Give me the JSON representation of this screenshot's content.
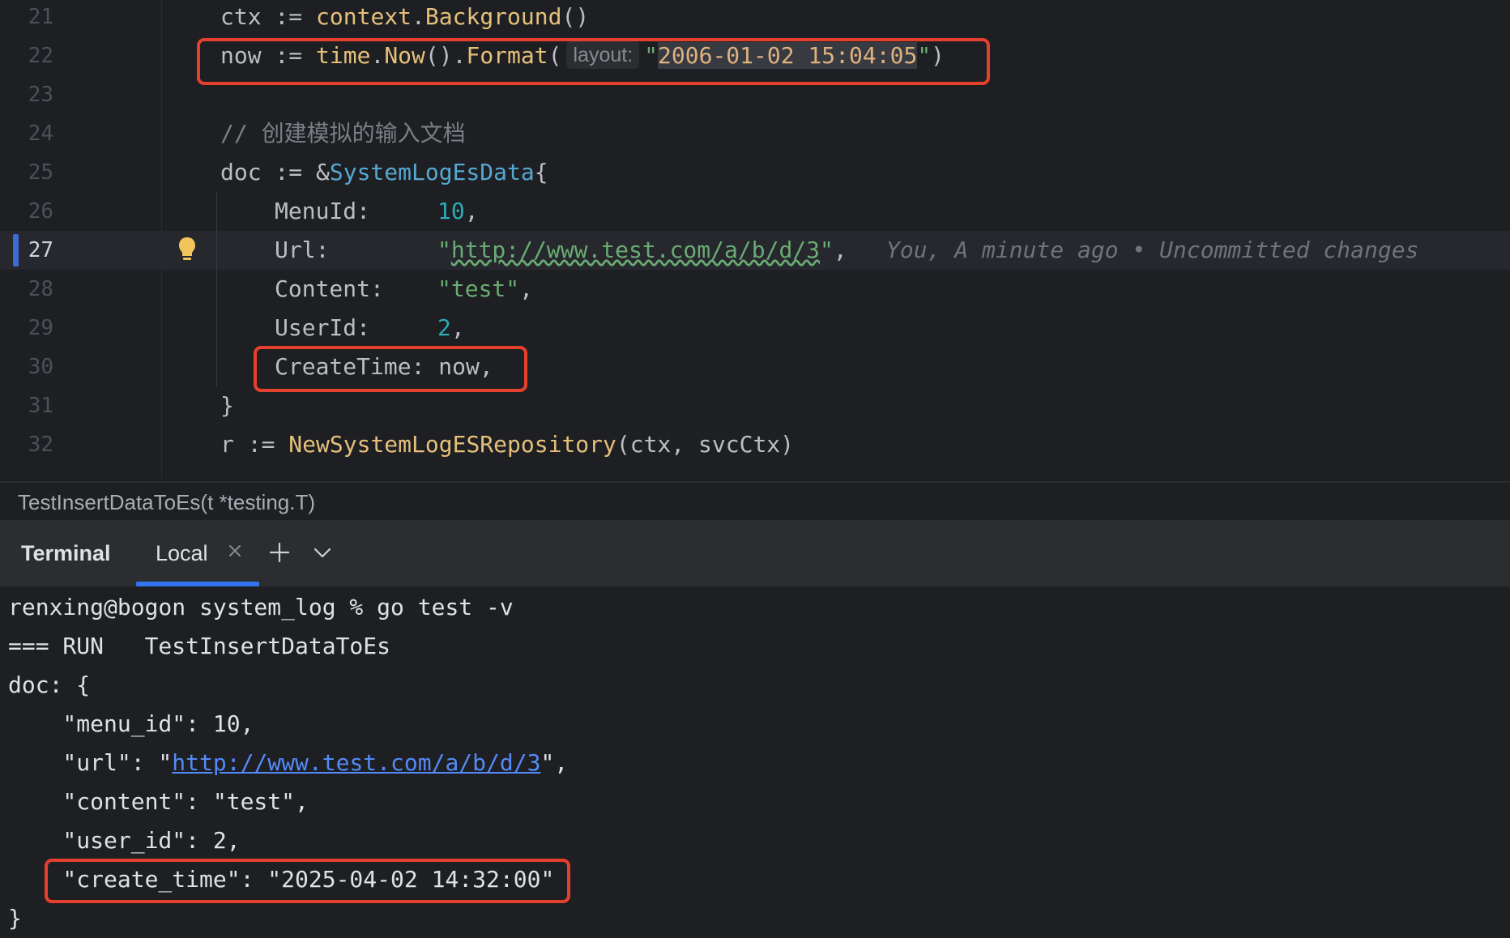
{
  "editor": {
    "lines": [
      {
        "num": "21"
      },
      {
        "num": "22"
      },
      {
        "num": "23"
      },
      {
        "num": "24"
      },
      {
        "num": "25"
      },
      {
        "num": "26"
      },
      {
        "num": "27"
      },
      {
        "num": "28"
      },
      {
        "num": "29"
      },
      {
        "num": "30"
      },
      {
        "num": "31"
      },
      {
        "num": "32"
      }
    ],
    "code": {
      "l21_a": "ctx := ",
      "l21_fn": "context",
      "l21_b": ".",
      "l21_fn2": "Background",
      "l21_c": "()",
      "l22_a": "now := ",
      "l22_fn": "time",
      "l22_b": ".",
      "l22_fn2": "Now",
      "l22_c": "().",
      "l22_fn3": "Format",
      "l22_d": "(",
      "l22_hint": "layout:",
      "l22_q1": "\"",
      "l22_str": "2006-01-02 15:04:05",
      "l22_q2": "\"",
      "l22_e": ")",
      "l24_cmt": "// 创建模拟的输入文档",
      "l25_a": "doc := &",
      "l25_ty": "SystemLogEsData",
      "l25_b": "{",
      "l26_key": "MenuId:",
      "l26_val": "10",
      "l26_c": ",",
      "l27_key": "Url:",
      "l27_q1": "\"",
      "l27_url": "http://www.test.com/a/b/d/3",
      "l27_q2": "\"",
      "l27_c": ",",
      "l27_blame": "You, A minute ago • Uncommitted changes",
      "l28_key": "Content:",
      "l28_val": "\"test\"",
      "l28_c": ",",
      "l29_key": "UserId:",
      "l29_val": "2",
      "l29_c": ",",
      "l30_text": "CreateTime: now,",
      "l31_text": "}",
      "l32_a": "r := ",
      "l32_fn": "NewSystemLogESRepository",
      "l32_b": "(ctx, svcCtx)"
    }
  },
  "breadcrumb": "TestInsertDataToEs(t *testing.T)",
  "terminal": {
    "title": "Terminal",
    "tab_label": "Local",
    "lines": {
      "prompt": "renxing@bogon system_log % go test -v",
      "run": "=== RUN   TestInsertDataToEs",
      "doc_open": "doc: {",
      "menu": "    \"menu_id\": 10,",
      "url_a": "    \"url\": \"",
      "url_link": "http://www.test.com/a/b/d/3",
      "url_b": "\",",
      "content": "    \"content\": \"test\",",
      "user": "    \"user_id\": 2,",
      "create": "    \"create_time\": \"2025-04-02 14:32:00\"",
      "close": "}"
    }
  },
  "colors": {
    "highlight_box": "#e5402d",
    "accent": "#3574f0",
    "bulb": "#f2c55c"
  },
  "icons": {
    "bulb": "lightbulb-icon",
    "close": "close-icon",
    "add": "plus-icon",
    "menu": "chevron-down-icon"
  }
}
